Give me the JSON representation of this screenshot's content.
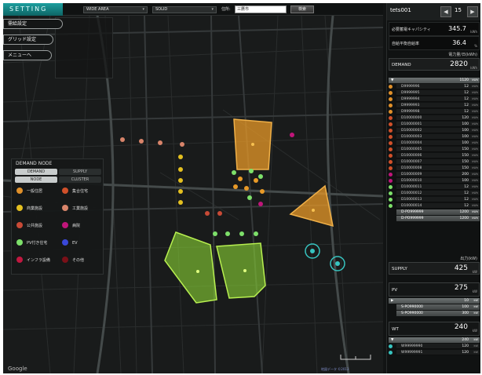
{
  "topbar": {
    "logo": "SETTING",
    "area_select": "WIDE AREA",
    "mode_select": "SOLID",
    "address_label": "住所:",
    "address_value": "三鷹市",
    "search_label": "検索"
  },
  "menu": {
    "items": [
      "需給設定",
      "グリッド設定",
      "メニューへ"
    ]
  },
  "legend": {
    "title": "DEMAND NODE",
    "tabs_row1": [
      "DEMAND",
      "SUPPLY"
    ],
    "tabs_row2": [
      "NODE",
      "CLUSTER"
    ],
    "items": [
      {
        "label": "一般住居",
        "color": "#e0902a"
      },
      {
        "label": "集合住宅",
        "color": "#d0502a"
      },
      {
        "label": "商業施設",
        "color": "#e4c020"
      },
      {
        "label": "工業施設",
        "color": "#d8846a"
      },
      {
        "label": "公共施設",
        "color": "#c84a36"
      },
      {
        "label": "病院",
        "color": "#c0157a"
      },
      {
        "label": "PV付き住宅",
        "color": "#7de06a"
      },
      {
        "label": "EV",
        "color": "#3a48d8"
      },
      {
        "label": "インフラ設備",
        "color": "#c01840"
      },
      {
        "label": "その他",
        "color": "#7a1018"
      }
    ]
  },
  "colors": {
    "accent": "#1d9e9e",
    "cluster_orange": "#e89a28",
    "cluster_green": "#8bd636"
  },
  "rpanel": {
    "name": "tets001",
    "prev_icon": "◀",
    "next_icon": "▶",
    "count": "15",
    "capacity": {
      "label": "必要蓄電キャパシティ",
      "value": "345.7",
      "unit": "kWh"
    },
    "selfsuff": {
      "label": "自給平衡自給率",
      "value": "36.4",
      "unit": "%"
    },
    "demand_caption": "電力量/日(kWh)",
    "demand": {
      "label": "DEMAND",
      "value": "2820",
      "unit": "kWh"
    },
    "demand_group": {
      "value": "1120",
      "unit": "kWh"
    },
    "demand_nodes": [
      {
        "id": "D9999996",
        "value": "12",
        "unit": "kWh",
        "color": "#e0902a"
      },
      {
        "id": "D9999995",
        "value": "12",
        "unit": "kWh",
        "color": "#e0902a"
      },
      {
        "id": "D9999994",
        "value": "12",
        "unit": "kWh",
        "color": "#e0902a"
      },
      {
        "id": "D9999993",
        "value": "12",
        "unit": "kWh",
        "color": "#e0902a"
      },
      {
        "id": "D9999998",
        "value": "12",
        "unit": "kWh",
        "color": "#e0902a"
      },
      {
        "id": "D10000000",
        "value": "120",
        "unit": "kWh",
        "color": "#d0502a"
      },
      {
        "id": "D10000001",
        "value": "100",
        "unit": "kWh",
        "color": "#d0502a"
      },
      {
        "id": "D10000002",
        "value": "100",
        "unit": "kWh",
        "color": "#d0502a"
      },
      {
        "id": "D10000003",
        "value": "100",
        "unit": "kWh",
        "color": "#d0502a"
      },
      {
        "id": "D10000004",
        "value": "100",
        "unit": "kWh",
        "color": "#d0502a"
      },
      {
        "id": "D10000005",
        "value": "150",
        "unit": "kWh",
        "color": "#d0502a"
      },
      {
        "id": "D10000006",
        "value": "150",
        "unit": "kWh",
        "color": "#d0502a"
      },
      {
        "id": "D10000007",
        "value": "150",
        "unit": "kWh",
        "color": "#d0502a"
      },
      {
        "id": "D10000008",
        "value": "150",
        "unit": "kWh",
        "color": "#d0502a"
      },
      {
        "id": "D10000009",
        "value": "200",
        "unit": "kWh",
        "color": "#c0157a"
      },
      {
        "id": "D10000010",
        "value": "100",
        "unit": "kWh",
        "color": "#c0157a"
      },
      {
        "id": "D10000011",
        "value": "12",
        "unit": "kWh",
        "color": "#7de06a"
      },
      {
        "id": "D10000012",
        "value": "12",
        "unit": "kWh",
        "color": "#7de06a"
      },
      {
        "id": "D10000013",
        "value": "12",
        "unit": "kWh",
        "color": "#7de06a"
      },
      {
        "id": "D10000014",
        "value": "12",
        "unit": "kWh",
        "color": "#7de06a"
      }
    ],
    "demand_subgroups": [
      {
        "id": "D-PO999999",
        "value": "1200",
        "unit": "kWh"
      },
      {
        "id": "D-PO999999",
        "value": "1200",
        "unit": "kWh"
      }
    ],
    "supply_caption": "出力(kW)",
    "supply": {
      "label": "SUPPLY",
      "value": "425",
      "unit": "kW"
    },
    "pv": {
      "label": "PV",
      "value": "275",
      "unit": "kW"
    },
    "pv_group": {
      "value": "10",
      "unit": "kW"
    },
    "pv_subgroups": [
      {
        "id": "S-PO990000",
        "value": "100",
        "unit": "kW"
      },
      {
        "id": "S-PO990000",
        "value": "300",
        "unit": "kW"
      }
    ],
    "wt": {
      "label": "WT",
      "value": "240",
      "unit": "kW"
    },
    "wt_group": {
      "value": "240",
      "unit": "kW"
    },
    "wt_nodes": [
      {
        "id": "W99999990",
        "value": "120",
        "unit": "kW",
        "color": "#37c4c0"
      },
      {
        "id": "W99999991",
        "value": "120",
        "unit": "kW",
        "color": "#37c4c0"
      }
    ]
  },
  "map": {
    "google": "Google",
    "copyright": "地図データ ©2013"
  }
}
